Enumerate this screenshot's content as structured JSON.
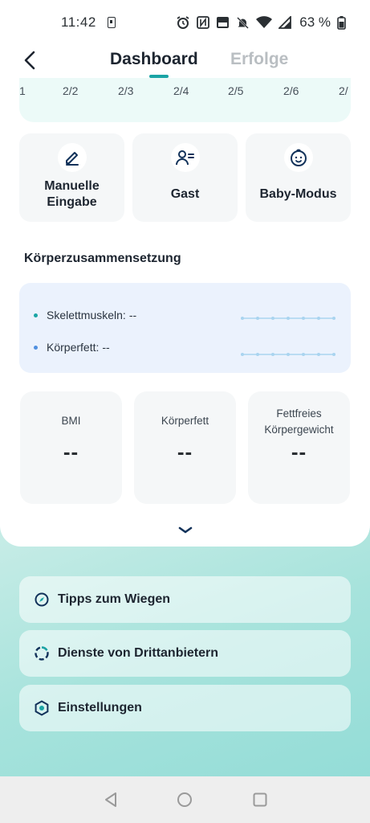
{
  "status_bar": {
    "time": "11:42",
    "battery_percent": "63 %",
    "icons": [
      "sim-icon",
      "alarm-icon",
      "nfc-icon",
      "volte-icon",
      "mute-icon",
      "wifi-icon",
      "signal-icon",
      "battery-icon"
    ]
  },
  "header": {
    "tabs": [
      {
        "label": "Dashboard",
        "active": true
      },
      {
        "label": "Erfolge",
        "active": false
      }
    ],
    "back_icon": "chevron-left-icon"
  },
  "date_strip": {
    "dates": [
      "1",
      "2/2",
      "2/3",
      "2/4",
      "2/5",
      "2/6",
      "2/"
    ]
  },
  "actions": [
    {
      "label": "Manuelle\nEingabe",
      "icon": "pencil-icon"
    },
    {
      "label": "Gast",
      "icon": "guest-user-icon"
    },
    {
      "label": "Baby-Modus",
      "icon": "baby-face-icon"
    }
  ],
  "body_composition": {
    "title": "Körperzusammensetzung",
    "rows": [
      {
        "label": "Skelettmuskeln:",
        "value": "--",
        "color": "#1aa4a5"
      },
      {
        "label": "Körperfett:",
        "value": "--",
        "color": "#4f8fe0"
      }
    ]
  },
  "metrics": [
    {
      "label": "BMI",
      "value": "--"
    },
    {
      "label": "Körperfett",
      "value": "--"
    },
    {
      "label": "Fettfreies\nKörpergewicht",
      "value": "--"
    }
  ],
  "menu": [
    {
      "label": "Tipps zum Wiegen",
      "icon": "compass-icon"
    },
    {
      "label": "Dienste von Drittanbietern",
      "icon": "dashed-circle-icon"
    },
    {
      "label": "Einstellungen",
      "icon": "hexagon-settings-icon"
    }
  ],
  "colors": {
    "accent": "#1aa4a5",
    "inactive_tab": "#b9bec2",
    "icon_navy": "#12325a"
  }
}
